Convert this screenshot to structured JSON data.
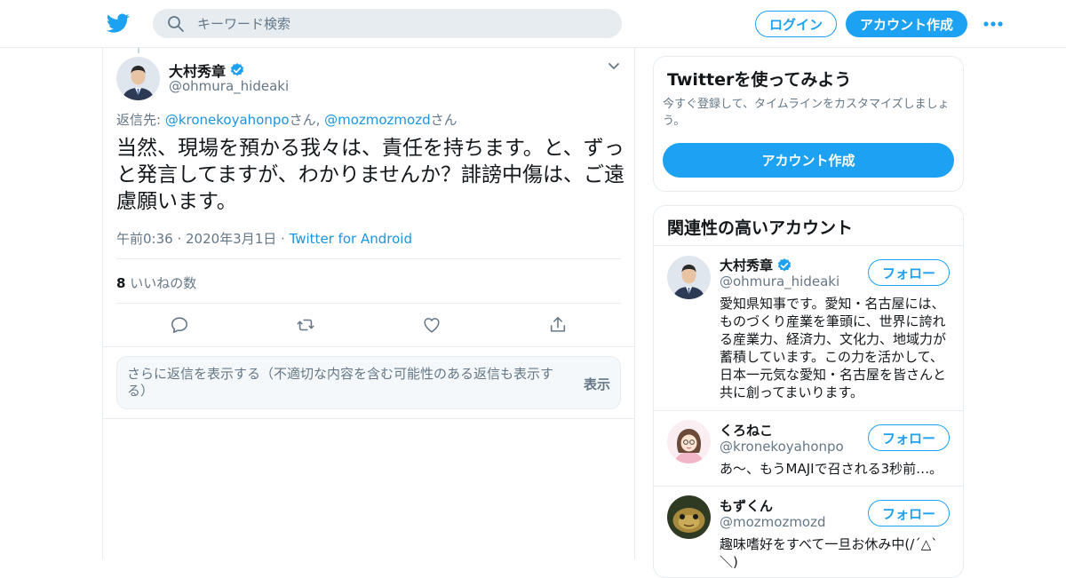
{
  "colors": {
    "accent": "#1da1f2",
    "link": "#1b95e0",
    "muted": "#657786",
    "border": "#e6ecf0"
  },
  "header": {
    "logo_icon": "twitter-bird-icon",
    "search_placeholder": "キーワード検索",
    "login_label": "ログイン",
    "signup_label": "アカウント作成",
    "more_icon": "more-dots-icon"
  },
  "tweet": {
    "author_name": "大村秀章",
    "author_handle": "@ohmura_hideaki",
    "verified": true,
    "reply_prefix": "返信先: ",
    "reply_user1": "@kronekoyahonpo",
    "reply_san1": "さん, ",
    "reply_user2": "@mozmozmozd",
    "reply_san2": "さん",
    "text": "当然、現場を預かる我々は、責任を持ちます。と、ずっと発言してますが、わかりませんか？誹謗中傷は、ご遠慮願います。",
    "timestamp": "午前0:36 · 2020年3月1日 · ",
    "source": "Twitter for Android",
    "like_count": "8",
    "like_label": " いいねの数",
    "more_replies_text": "さらに返信を表示する（不適切な内容を含む可能性のある返信も表示する）",
    "show_label": "表示"
  },
  "sidebar": {
    "signup_card": {
      "title": "Twitterを使ってみよう",
      "description": "今すぐ登録して、タイムラインをカスタマイズしましょう。",
      "button_label": "アカウント作成"
    },
    "related": {
      "title": "関連性の高いアカウント",
      "follow_label": "フォロー",
      "accounts": [
        {
          "name": "大村秀章",
          "handle": "@ohmura_hideaki",
          "verified": true,
          "bio": "愛知県知事です。愛知・名古屋には、ものづくり産業を筆頭に、世界に誇れる産業力、経済力、文化力、地域力が蓄積しています。この力を活かして、日本一元気な愛知・名古屋を皆さんと共に創ってまいります。"
        },
        {
          "name": "くろねこ",
          "handle": "@kronekoyahonpo",
          "verified": false,
          "bio": "あ〜、もうMAJIで召される3秒前…。"
        },
        {
          "name": "もずくん",
          "handle": "@mozmozmozd",
          "verified": false,
          "bio": "趣味嗜好をすべて一旦お休み中(/´△`＼)"
        }
      ]
    }
  }
}
